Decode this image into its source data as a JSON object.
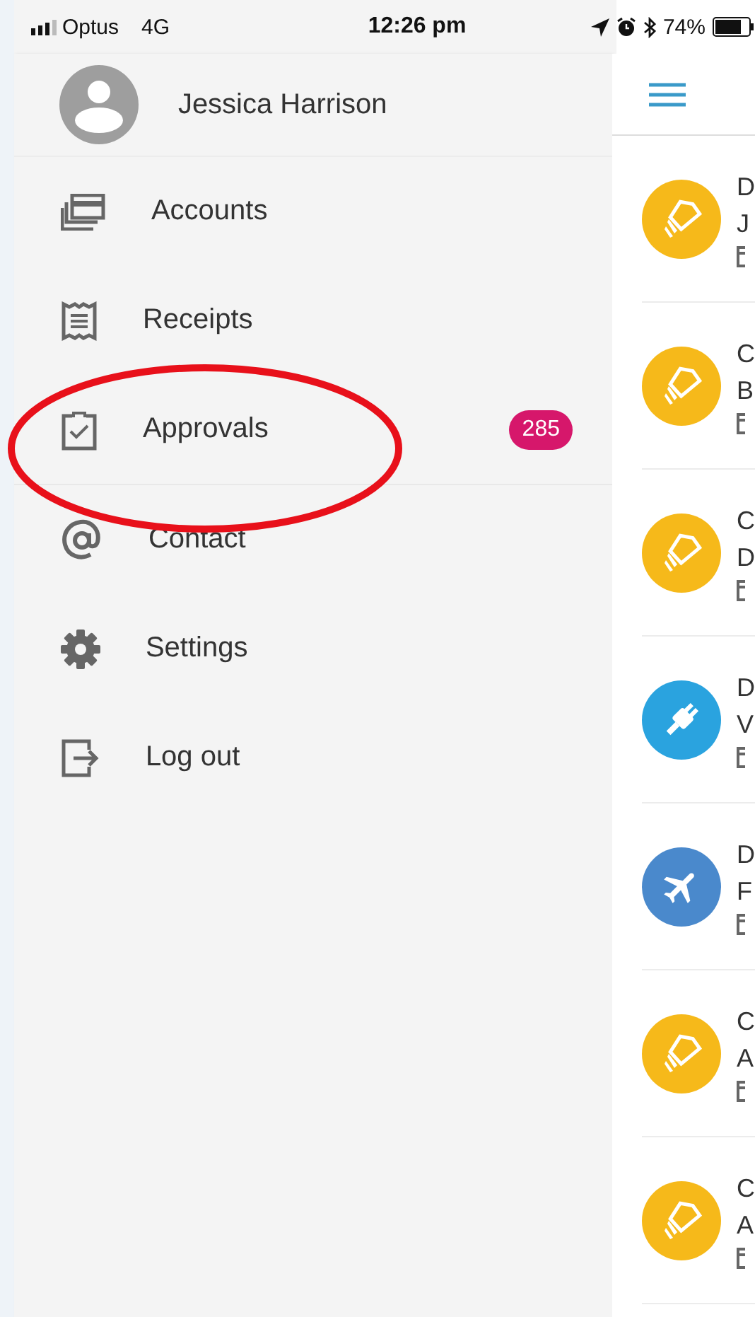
{
  "status_bar": {
    "carrier": "Optus",
    "network": "4G",
    "time": "12:26 pm",
    "battery": "74%"
  },
  "drawer": {
    "user_name": "Jessica Harrison",
    "items": [
      {
        "label": "Accounts"
      },
      {
        "label": "Receipts"
      },
      {
        "label": "Approvals",
        "badge": "285"
      },
      {
        "label": "Contact"
      },
      {
        "label": "Settings"
      },
      {
        "label": "Log out"
      }
    ]
  },
  "list": {
    "rows": [
      {
        "kind": "tag",
        "color": "#f6b91a",
        "title": "D",
        "subtitle": "J"
      },
      {
        "kind": "tag",
        "color": "#f6b91a",
        "title": "C",
        "subtitle": "B"
      },
      {
        "kind": "tag",
        "color": "#f6b91a",
        "title": "C",
        "subtitle": "D"
      },
      {
        "kind": "plug",
        "color": "#2aa3df",
        "title": "D",
        "subtitle": "V"
      },
      {
        "kind": "plane",
        "color": "#4a89cc",
        "title": "D",
        "subtitle": "F"
      },
      {
        "kind": "tag",
        "color": "#f6b91a",
        "title": "C",
        "subtitle": "A"
      },
      {
        "kind": "tag",
        "color": "#f6b91a",
        "title": "C",
        "subtitle": "A"
      }
    ]
  }
}
